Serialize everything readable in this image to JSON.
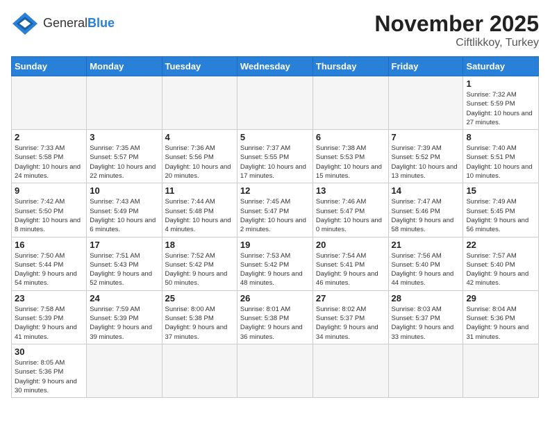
{
  "header": {
    "logo_general": "General",
    "logo_blue": "Blue",
    "title": "November 2025",
    "subtitle": "Ciftlikkoy, Turkey"
  },
  "days_of_week": [
    "Sunday",
    "Monday",
    "Tuesday",
    "Wednesday",
    "Thursday",
    "Friday",
    "Saturday"
  ],
  "weeks": [
    [
      {
        "day": "",
        "info": ""
      },
      {
        "day": "",
        "info": ""
      },
      {
        "day": "",
        "info": ""
      },
      {
        "day": "",
        "info": ""
      },
      {
        "day": "",
        "info": ""
      },
      {
        "day": "",
        "info": ""
      },
      {
        "day": "1",
        "info": "Sunrise: 7:32 AM\nSunset: 5:59 PM\nDaylight: 10 hours\nand 27 minutes."
      }
    ],
    [
      {
        "day": "2",
        "info": "Sunrise: 7:33 AM\nSunset: 5:58 PM\nDaylight: 10 hours\nand 24 minutes."
      },
      {
        "day": "3",
        "info": "Sunrise: 7:35 AM\nSunset: 5:57 PM\nDaylight: 10 hours\nand 22 minutes."
      },
      {
        "day": "4",
        "info": "Sunrise: 7:36 AM\nSunset: 5:56 PM\nDaylight: 10 hours\nand 20 minutes."
      },
      {
        "day": "5",
        "info": "Sunrise: 7:37 AM\nSunset: 5:55 PM\nDaylight: 10 hours\nand 17 minutes."
      },
      {
        "day": "6",
        "info": "Sunrise: 7:38 AM\nSunset: 5:53 PM\nDaylight: 10 hours\nand 15 minutes."
      },
      {
        "day": "7",
        "info": "Sunrise: 7:39 AM\nSunset: 5:52 PM\nDaylight: 10 hours\nand 13 minutes."
      },
      {
        "day": "8",
        "info": "Sunrise: 7:40 AM\nSunset: 5:51 PM\nDaylight: 10 hours\nand 10 minutes."
      }
    ],
    [
      {
        "day": "9",
        "info": "Sunrise: 7:42 AM\nSunset: 5:50 PM\nDaylight: 10 hours\nand 8 minutes."
      },
      {
        "day": "10",
        "info": "Sunrise: 7:43 AM\nSunset: 5:49 PM\nDaylight: 10 hours\nand 6 minutes."
      },
      {
        "day": "11",
        "info": "Sunrise: 7:44 AM\nSunset: 5:48 PM\nDaylight: 10 hours\nand 4 minutes."
      },
      {
        "day": "12",
        "info": "Sunrise: 7:45 AM\nSunset: 5:47 PM\nDaylight: 10 hours\nand 2 minutes."
      },
      {
        "day": "13",
        "info": "Sunrise: 7:46 AM\nSunset: 5:47 PM\nDaylight: 10 hours\nand 0 minutes."
      },
      {
        "day": "14",
        "info": "Sunrise: 7:47 AM\nSunset: 5:46 PM\nDaylight: 9 hours\nand 58 minutes."
      },
      {
        "day": "15",
        "info": "Sunrise: 7:49 AM\nSunset: 5:45 PM\nDaylight: 9 hours\nand 56 minutes."
      }
    ],
    [
      {
        "day": "16",
        "info": "Sunrise: 7:50 AM\nSunset: 5:44 PM\nDaylight: 9 hours\nand 54 minutes."
      },
      {
        "day": "17",
        "info": "Sunrise: 7:51 AM\nSunset: 5:43 PM\nDaylight: 9 hours\nand 52 minutes."
      },
      {
        "day": "18",
        "info": "Sunrise: 7:52 AM\nSunset: 5:42 PM\nDaylight: 9 hours\nand 50 minutes."
      },
      {
        "day": "19",
        "info": "Sunrise: 7:53 AM\nSunset: 5:42 PM\nDaylight: 9 hours\nand 48 minutes."
      },
      {
        "day": "20",
        "info": "Sunrise: 7:54 AM\nSunset: 5:41 PM\nDaylight: 9 hours\nand 46 minutes."
      },
      {
        "day": "21",
        "info": "Sunrise: 7:56 AM\nSunset: 5:40 PM\nDaylight: 9 hours\nand 44 minutes."
      },
      {
        "day": "22",
        "info": "Sunrise: 7:57 AM\nSunset: 5:40 PM\nDaylight: 9 hours\nand 42 minutes."
      }
    ],
    [
      {
        "day": "23",
        "info": "Sunrise: 7:58 AM\nSunset: 5:39 PM\nDaylight: 9 hours\nand 41 minutes."
      },
      {
        "day": "24",
        "info": "Sunrise: 7:59 AM\nSunset: 5:39 PM\nDaylight: 9 hours\nand 39 minutes."
      },
      {
        "day": "25",
        "info": "Sunrise: 8:00 AM\nSunset: 5:38 PM\nDaylight: 9 hours\nand 37 minutes."
      },
      {
        "day": "26",
        "info": "Sunrise: 8:01 AM\nSunset: 5:38 PM\nDaylight: 9 hours\nand 36 minutes."
      },
      {
        "day": "27",
        "info": "Sunrise: 8:02 AM\nSunset: 5:37 PM\nDaylight: 9 hours\nand 34 minutes."
      },
      {
        "day": "28",
        "info": "Sunrise: 8:03 AM\nSunset: 5:37 PM\nDaylight: 9 hours\nand 33 minutes."
      },
      {
        "day": "29",
        "info": "Sunrise: 8:04 AM\nSunset: 5:36 PM\nDaylight: 9 hours\nand 31 minutes."
      }
    ],
    [
      {
        "day": "30",
        "info": "Sunrise: 8:05 AM\nSunset: 5:36 PM\nDaylight: 9 hours\nand 30 minutes."
      },
      {
        "day": "",
        "info": ""
      },
      {
        "day": "",
        "info": ""
      },
      {
        "day": "",
        "info": ""
      },
      {
        "day": "",
        "info": ""
      },
      {
        "day": "",
        "info": ""
      },
      {
        "day": "",
        "info": ""
      }
    ]
  ]
}
